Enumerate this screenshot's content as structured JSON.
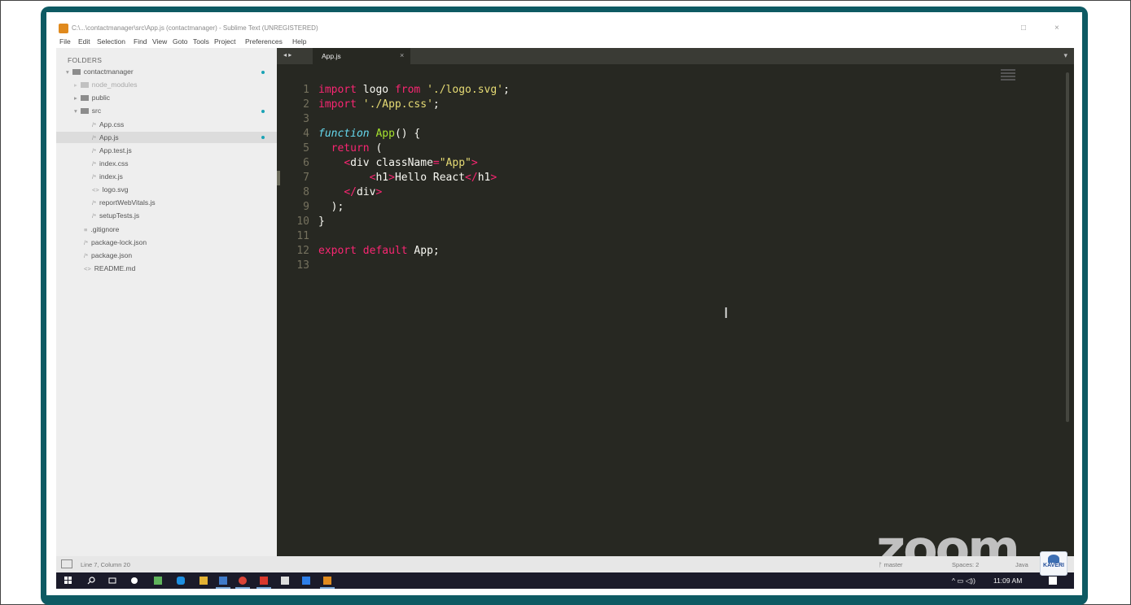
{
  "window": {
    "title": "C:\\...\\contactmanager\\src\\App.js (contactmanager) - Sublime Text (UNREGISTERED)",
    "controls": [
      "□",
      "×"
    ]
  },
  "menu": [
    "File",
    "Edit",
    "Selection",
    "Find",
    "View",
    "Goto",
    "Tools",
    "Project",
    "Preferences",
    "Help"
  ],
  "sidebar": {
    "title": "FOLDERS",
    "items": [
      {
        "label": "contactmanager",
        "glyph": "▾"
      },
      {
        "label": "node_modules",
        "glyph": "▸"
      },
      {
        "label": "public",
        "glyph": "▸"
      },
      {
        "label": "src",
        "glyph": "▾"
      },
      {
        "label": "App.css",
        "glyph": "/*"
      },
      {
        "label": "App.js",
        "glyph": "/*"
      },
      {
        "label": "App.test.js",
        "glyph": "/*"
      },
      {
        "label": "index.css",
        "glyph": "/*"
      },
      {
        "label": "index.js",
        "glyph": "/*"
      },
      {
        "label": "logo.svg",
        "glyph": "<>"
      },
      {
        "label": "reportWebVitals.js",
        "glyph": "/*"
      },
      {
        "label": "setupTests.js",
        "glyph": "/*"
      },
      {
        "label": ".gitignore",
        "glyph": "≡"
      },
      {
        "label": "package-lock.json",
        "glyph": "/*"
      },
      {
        "label": "package.json",
        "glyph": "/*"
      },
      {
        "label": "README.md",
        "glyph": "<>"
      }
    ]
  },
  "tabs": {
    "nav": "◂ ▸",
    "active": {
      "label": "App.js",
      "close": "×"
    },
    "dropdown": "▾"
  },
  "editor": {
    "line_numbers": [
      "1",
      "2",
      "3",
      "4",
      "5",
      "6",
      "7",
      "8",
      "9",
      "10",
      "11",
      "12",
      "13"
    ],
    "lines": [
      [
        {
          "t": "import",
          "c": "kw"
        },
        {
          "t": " logo "
        },
        {
          "t": "from",
          "c": "kw"
        },
        {
          "t": " "
        },
        {
          "t": "'./logo.svg'",
          "c": "str"
        },
        {
          "t": ";"
        }
      ],
      [
        {
          "t": "import",
          "c": "kw"
        },
        {
          "t": " "
        },
        {
          "t": "'./App.css'",
          "c": "str"
        },
        {
          "t": ";"
        }
      ],
      [],
      [
        {
          "t": "function",
          "c": "italic-kw"
        },
        {
          "t": " "
        },
        {
          "t": "App",
          "c": "fn"
        },
        {
          "t": "() {"
        }
      ],
      [
        {
          "t": "  "
        },
        {
          "t": "return",
          "c": "kw"
        },
        {
          "t": " ("
        }
      ],
      [
        {
          "t": "    "
        },
        {
          "t": "<",
          "c": "tag"
        },
        {
          "t": "div",
          "c": "plain"
        },
        {
          "t": " className",
          "c": "plain"
        },
        {
          "t": "=",
          "c": "tag"
        },
        {
          "t": "\"App\"",
          "c": "str"
        },
        {
          "t": ">",
          "c": "tag"
        }
      ],
      [
        {
          "t": "        "
        },
        {
          "t": "<",
          "c": "tag"
        },
        {
          "t": "h1"
        },
        {
          "t": ">",
          "c": "tag"
        },
        {
          "t": "Hello React"
        },
        {
          "t": "</",
          "c": "tag"
        },
        {
          "t": "h1"
        },
        {
          "t": ">",
          "c": "tag"
        }
      ],
      [
        {
          "t": "    "
        },
        {
          "t": "</",
          "c": "tag"
        },
        {
          "t": "div"
        },
        {
          "t": ">",
          "c": "tag"
        }
      ],
      [
        {
          "t": "  );"
        }
      ],
      [
        {
          "t": "}"
        }
      ],
      [],
      [
        {
          "t": "export",
          "c": "kw"
        },
        {
          "t": " "
        },
        {
          "t": "default",
          "c": "kw"
        },
        {
          "t": " App;"
        }
      ],
      []
    ]
  },
  "watermark": "zoom",
  "statusbar": {
    "position": "Line 7, Column 20",
    "branch": "ᚠ master",
    "spaces": "Spaces: 2",
    "syntax": "Java"
  },
  "taskbar": {
    "tray": "^ ▭ ◁))",
    "time": "11:09 AM"
  },
  "badge": "KAVERI",
  "colors": {
    "frame": "#0e5a63",
    "editor_bg": "#272822",
    "keyword": "#f92672",
    "string": "#e6db74",
    "function": "#a6e22e",
    "storage": "#66d9ef"
  }
}
